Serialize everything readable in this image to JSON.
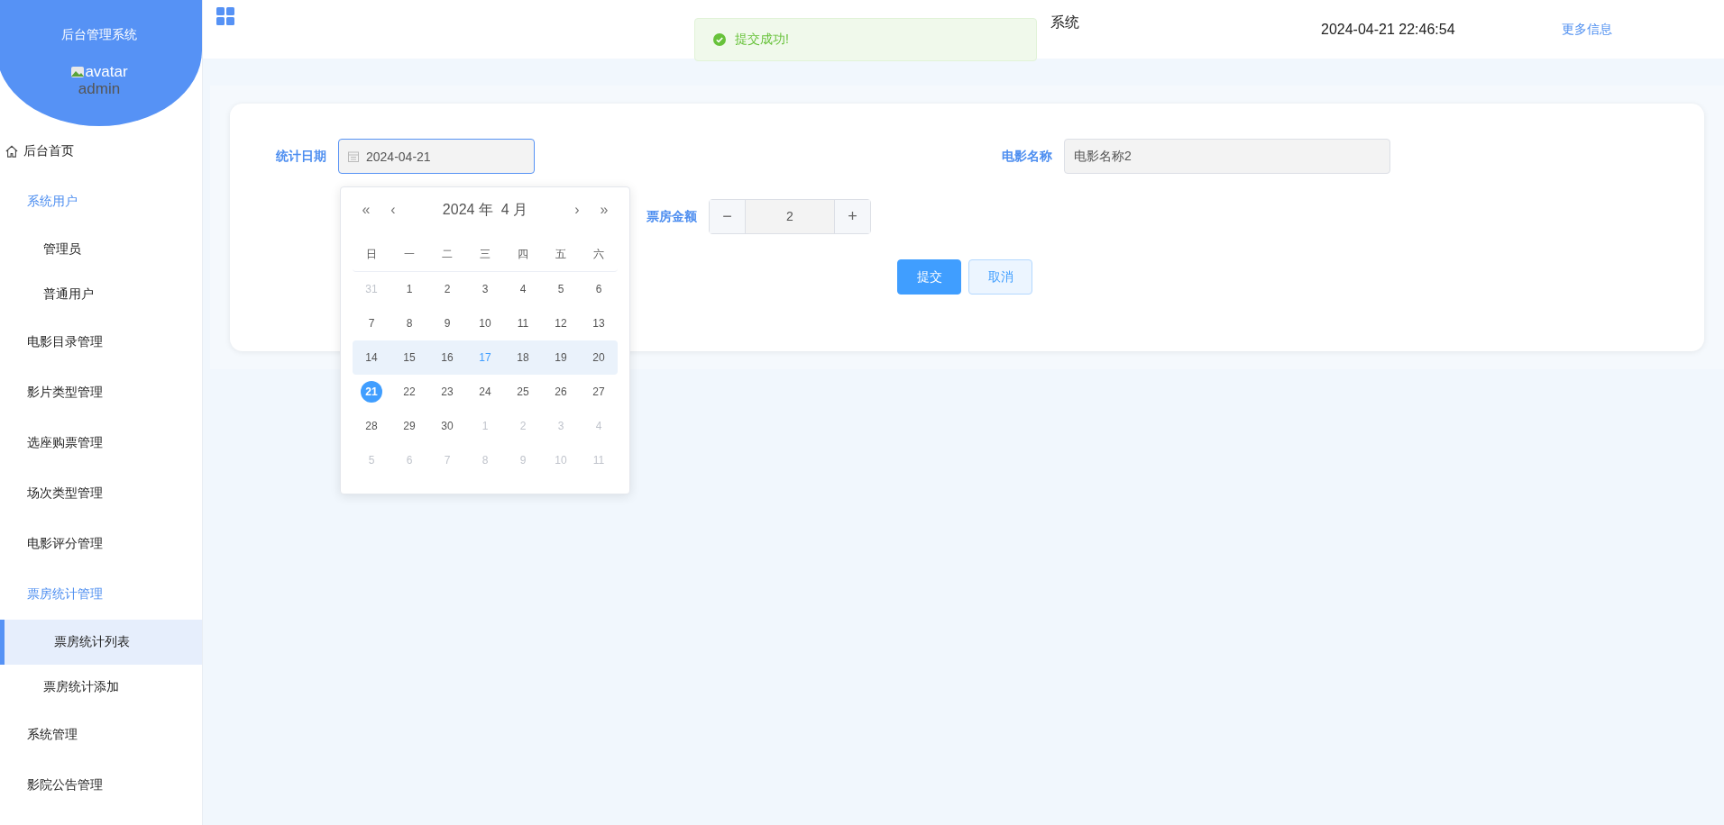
{
  "sidebar": {
    "title": "后台管理系统",
    "avatar_alt": "avatar",
    "username": "admin",
    "items": [
      {
        "label": "后台首页",
        "kind": "home",
        "expanded": false
      },
      {
        "label": "系统用户",
        "kind": "group",
        "expanded": true,
        "children": [
          {
            "label": "管理员",
            "selected": false
          },
          {
            "label": "普通用户",
            "selected": false
          }
        ]
      },
      {
        "label": "电影目录管理",
        "kind": "group",
        "expanded": false
      },
      {
        "label": "影片类型管理",
        "kind": "group",
        "expanded": false
      },
      {
        "label": "选座购票管理",
        "kind": "group",
        "expanded": false
      },
      {
        "label": "场次类型管理",
        "kind": "group",
        "expanded": false
      },
      {
        "label": "电影评分管理",
        "kind": "group",
        "expanded": false
      },
      {
        "label": "票房统计管理",
        "kind": "group",
        "expanded": true,
        "children": [
          {
            "label": "票房统计列表",
            "selected": true
          },
          {
            "label": "票房统计添加",
            "selected": false
          }
        ]
      },
      {
        "label": "系统管理",
        "kind": "group",
        "expanded": false
      },
      {
        "label": "影院公告管理",
        "kind": "group",
        "expanded": false
      }
    ]
  },
  "header": {
    "title": "系统",
    "datetime": "2024-04-21 22:46:54",
    "more_link": "更多信息"
  },
  "toast": {
    "kind": "success",
    "message": "提交成功!"
  },
  "form": {
    "date": {
      "label": "统计日期",
      "value": "2024-04-21"
    },
    "movie": {
      "label": "电影名称",
      "value": "电影名称2"
    },
    "amount": {
      "label": "票房金额",
      "value": "2",
      "minus": "−",
      "plus": "+"
    },
    "buttons": [
      {
        "label": "提交",
        "kind": "primary"
      },
      {
        "label": "取消",
        "kind": "secondary"
      }
    ]
  },
  "calendar": {
    "prev_year": "«",
    "prev_month": "‹",
    "title": "2024 年  4 月",
    "next_month": "›",
    "next_year": "»",
    "weekdays": [
      "日",
      "一",
      "二",
      "三",
      "四",
      "五",
      "六"
    ],
    "weeks": [
      {
        "hovered": false,
        "days": [
          {
            "label": "31",
            "kind": "other",
            "selected": false,
            "today": false
          },
          {
            "label": "1",
            "kind": "current",
            "selected": false,
            "today": false
          },
          {
            "label": "2",
            "kind": "current",
            "selected": false,
            "today": false
          },
          {
            "label": "3",
            "kind": "current",
            "selected": false,
            "today": false
          },
          {
            "label": "4",
            "kind": "current",
            "selected": false,
            "today": false
          },
          {
            "label": "5",
            "kind": "current",
            "selected": false,
            "today": false
          },
          {
            "label": "6",
            "kind": "current",
            "selected": false,
            "today": false
          }
        ]
      },
      {
        "hovered": false,
        "days": [
          {
            "label": "7",
            "kind": "current",
            "selected": false,
            "today": false
          },
          {
            "label": "8",
            "kind": "current",
            "selected": false,
            "today": false
          },
          {
            "label": "9",
            "kind": "current",
            "selected": false,
            "today": false
          },
          {
            "label": "10",
            "kind": "current",
            "selected": false,
            "today": false
          },
          {
            "label": "11",
            "kind": "current",
            "selected": false,
            "today": false
          },
          {
            "label": "12",
            "kind": "current",
            "selected": false,
            "today": false
          },
          {
            "label": "13",
            "kind": "current",
            "selected": false,
            "today": false
          }
        ]
      },
      {
        "hovered": true,
        "days": [
          {
            "label": "14",
            "kind": "current",
            "selected": false,
            "today": false
          },
          {
            "label": "15",
            "kind": "current",
            "selected": false,
            "today": false
          },
          {
            "label": "16",
            "kind": "current",
            "selected": false,
            "today": false
          },
          {
            "label": "17",
            "kind": "current",
            "selected": false,
            "today": true
          },
          {
            "label": "18",
            "kind": "current",
            "selected": false,
            "today": false
          },
          {
            "label": "19",
            "kind": "current",
            "selected": false,
            "today": false
          },
          {
            "label": "20",
            "kind": "current",
            "selected": false,
            "today": false
          }
        ]
      },
      {
        "hovered": false,
        "days": [
          {
            "label": "21",
            "kind": "current",
            "selected": true,
            "today": false
          },
          {
            "label": "22",
            "kind": "current",
            "selected": false,
            "today": false
          },
          {
            "label": "23",
            "kind": "current",
            "selected": false,
            "today": false
          },
          {
            "label": "24",
            "kind": "current",
            "selected": false,
            "today": false
          },
          {
            "label": "25",
            "kind": "current",
            "selected": false,
            "today": false
          },
          {
            "label": "26",
            "kind": "current",
            "selected": false,
            "today": false
          },
          {
            "label": "27",
            "kind": "current",
            "selected": false,
            "today": false
          }
        ]
      },
      {
        "hovered": false,
        "days": [
          {
            "label": "28",
            "kind": "current",
            "selected": false,
            "today": false
          },
          {
            "label": "29",
            "kind": "current",
            "selected": false,
            "today": false
          },
          {
            "label": "30",
            "kind": "current",
            "selected": false,
            "today": false
          },
          {
            "label": "1",
            "kind": "other",
            "selected": false,
            "today": false
          },
          {
            "label": "2",
            "kind": "other",
            "selected": false,
            "today": false
          },
          {
            "label": "3",
            "kind": "other",
            "selected": false,
            "today": false
          },
          {
            "label": "4",
            "kind": "other",
            "selected": false,
            "today": false
          }
        ]
      },
      {
        "hovered": false,
        "days": [
          {
            "label": "5",
            "kind": "other",
            "selected": false,
            "today": false
          },
          {
            "label": "6",
            "kind": "other",
            "selected": false,
            "today": false
          },
          {
            "label": "7",
            "kind": "other",
            "selected": false,
            "today": false
          },
          {
            "label": "8",
            "kind": "other",
            "selected": false,
            "today": false
          },
          {
            "label": "9",
            "kind": "other",
            "selected": false,
            "today": false
          },
          {
            "label": "10",
            "kind": "other",
            "selected": false,
            "today": false
          },
          {
            "label": "11",
            "kind": "other",
            "selected": false,
            "today": false
          }
        ]
      }
    ]
  }
}
